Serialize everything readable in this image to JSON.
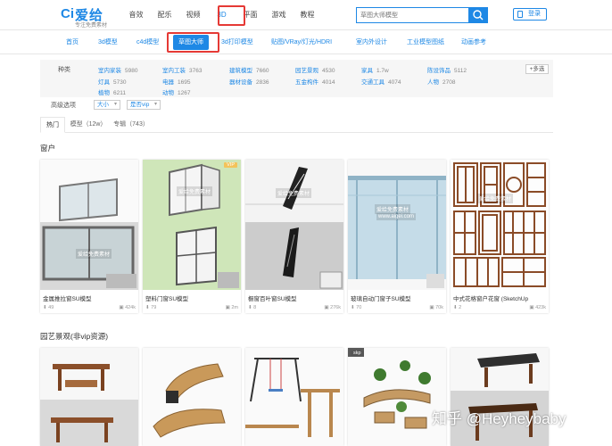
{
  "header": {
    "logo_mark": "Ci",
    "logo_text": "爱给",
    "logo_sub": "专注免费素材",
    "nav": [
      "音效",
      "配乐",
      "视频",
      "3D",
      "平面",
      "游戏",
      "教程"
    ],
    "search_placeholder": "草图大师模型",
    "login": "登录"
  },
  "subnav": {
    "items": [
      "首页",
      "3d模型",
      "c4d模型",
      "草图大师",
      "3d打印模型",
      "贴图/VRay/灯光/HDRI",
      "室内外设计",
      "工业模型图纸",
      "动画参考"
    ]
  },
  "filter": {
    "label": "种类",
    "rows": [
      [
        {
          "name": "室内家装",
          "count": "5980"
        },
        {
          "name": "室内工装",
          "count": "3763"
        },
        {
          "name": "建筑模型",
          "count": "7660"
        },
        {
          "name": "园艺景观",
          "count": "4530"
        },
        {
          "name": "家具",
          "count": "1.7w"
        },
        {
          "name": "陈设饰品",
          "count": "5112"
        }
      ],
      [
        {
          "name": "灯具",
          "count": "5730"
        },
        {
          "name": "电器",
          "count": "1695"
        },
        {
          "name": "器材设备",
          "count": "2836"
        },
        {
          "name": "五金构件",
          "count": "4014"
        },
        {
          "name": "交通工具",
          "count": "4074"
        },
        {
          "name": "人物",
          "count": "2708"
        }
      ],
      [
        {
          "name": "植物",
          "count": "6211"
        },
        {
          "name": "动物",
          "count": "1267"
        }
      ]
    ],
    "more": "+多选"
  },
  "advanced": {
    "label": "高级选项",
    "size": "大小",
    "vip": "是否vip"
  },
  "tabs": [
    "热门",
    "模型（12w）",
    "专辑（743）"
  ],
  "sections": {
    "window": "窗户",
    "garden": "园艺景观(非vip资源)"
  },
  "cards": [
    {
      "title": "金属推拉窗SU模型",
      "downloads": "49",
      "size": "424k",
      "vip": ""
    },
    {
      "title": "塑料门窗SU模型",
      "downloads": "79",
      "size": "2m",
      "vip": "VIP"
    },
    {
      "title": "橱窗百叶窗SU模型",
      "downloads": "8",
      "size": "276k",
      "vip": ""
    },
    {
      "title": "玻璃自动门窗子SU模型",
      "downloads": "70",
      "size": "70k",
      "vip": ""
    },
    {
      "title": "中式花格窗户花窗 (SketchUp",
      "downloads": "2",
      "size": "423k",
      "vip": ""
    }
  ],
  "thumb_watermark": "爱给免费素材",
  "thumb_watermark_url": "www.aigei.com",
  "card2_badge": "skp",
  "overlay_watermark": "知乎 @Heyheybaby",
  "colors": {
    "accent": "#1e88e5",
    "highlight": "#e53935"
  }
}
